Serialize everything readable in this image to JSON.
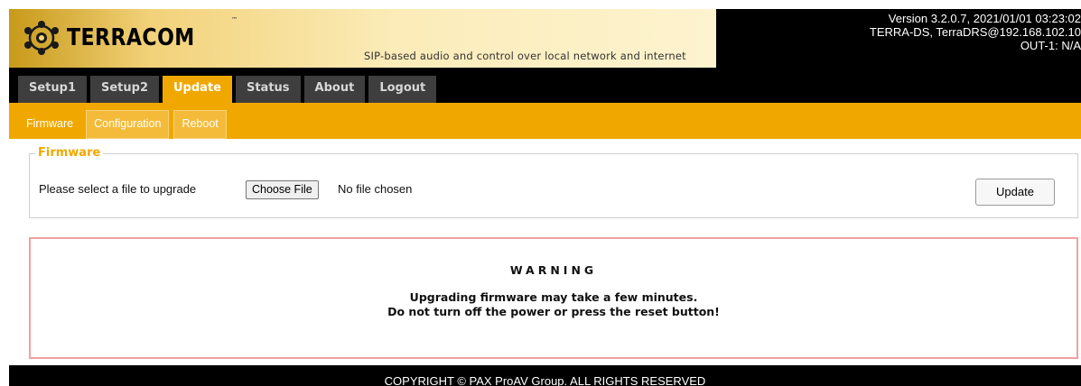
{
  "header": {
    "logo_text": "TERRACOM",
    "logo_tm": "™",
    "tagline": "SIP-based audio and control over local network and internet",
    "version": "Version 3.2.0.7, 2021/01/01 03:23:02",
    "device": "TERRA-DS, TerraDRS@192.168.102.10",
    "output": "OUT-1: N/A"
  },
  "main_tabs": [
    {
      "label": "Setup1",
      "active": false
    },
    {
      "label": "Setup2",
      "active": false
    },
    {
      "label": "Update",
      "active": true
    },
    {
      "label": "Status",
      "active": false
    },
    {
      "label": "About",
      "active": false
    },
    {
      "label": "Logout",
      "active": false
    }
  ],
  "sub_tabs": [
    {
      "label": "Firmware",
      "active": true
    },
    {
      "label": "Configuration",
      "active": false
    },
    {
      "label": "Reboot",
      "active": false
    }
  ],
  "firmware": {
    "legend": "Firmware",
    "select_label": "Please select a file to upgrade",
    "choose_file_label": "Choose File",
    "no_file_text": "No file chosen",
    "update_label": "Update"
  },
  "warning": {
    "title": "WARNING",
    "line1": "Upgrading firmware may take a few minutes.",
    "line2": "Do not turn off the power or press the reset button!"
  },
  "footer": "COPYRIGHT © PAX ProAV Group. ALL RIGHTS RESERVED",
  "colors": {
    "accent": "#f0a800",
    "tab_inactive": "#3e3e3e",
    "warning_border": "#f2a0a0"
  },
  "icons": {
    "logo": "terracom-logo-icon"
  }
}
